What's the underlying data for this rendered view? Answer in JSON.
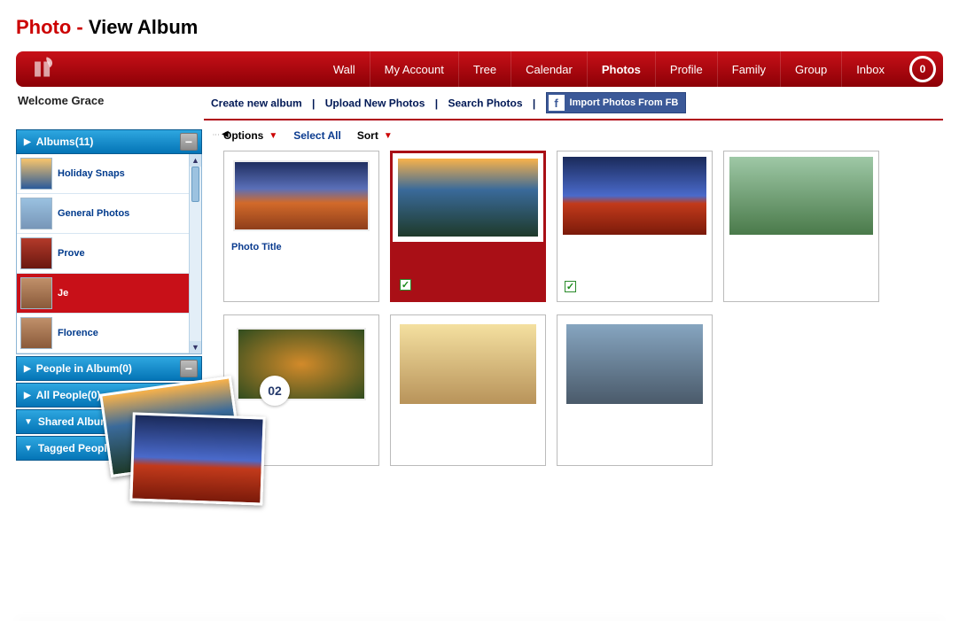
{
  "page_title_prefix": "Photo - ",
  "page_title_main": "View Album",
  "topnav": {
    "items": [
      "Wall",
      "My Account",
      "Tree",
      "Calendar",
      "Photos",
      "Profile",
      "Family",
      "Group",
      "Inbox"
    ],
    "active_index": 4,
    "badge": "0"
  },
  "welcome": "Welcome Grace",
  "subnav": {
    "create": "Create new album",
    "upload": "Upload New Photos",
    "search": "Search Photos",
    "fb": "Import Photos From FB"
  },
  "toolbar": {
    "options": "Options",
    "select_all": "Select All",
    "sort": "Sort"
  },
  "sidebar": {
    "sections": [
      {
        "title": "Albums(11)",
        "expanded": true,
        "toggle": "−"
      },
      {
        "title": "People in Album(0)",
        "expanded": true,
        "toggle": "−"
      },
      {
        "title": "All People(0)",
        "expanded": true,
        "toggle": "−"
      },
      {
        "title": "Shared Album(15)",
        "expanded": false,
        "toggle": "+"
      },
      {
        "title": "Tagged People(25)",
        "expanded": false,
        "toggle": "+"
      }
    ],
    "albums": [
      {
        "label": "Holiday Snaps",
        "img": "boats"
      },
      {
        "label": "General Photos",
        "img": "paris"
      },
      {
        "label": "Prove",
        "img": "beans"
      },
      {
        "label": "Je",
        "img": "dome",
        "selected": true
      },
      {
        "label": "Florence",
        "img": "dome"
      }
    ]
  },
  "drag": {
    "count": "02"
  },
  "grid": {
    "row1": [
      {
        "img": "arc",
        "caption": "Photo Title",
        "rough": true
      },
      {
        "img": "lake",
        "selected": true,
        "checked": true
      },
      {
        "img": "bridge",
        "checked": true
      },
      {
        "img": "eagle"
      }
    ],
    "row2": [
      {
        "img": "butterfly",
        "rough": true
      },
      {
        "img": "gate"
      },
      {
        "img": "museum"
      }
    ]
  }
}
